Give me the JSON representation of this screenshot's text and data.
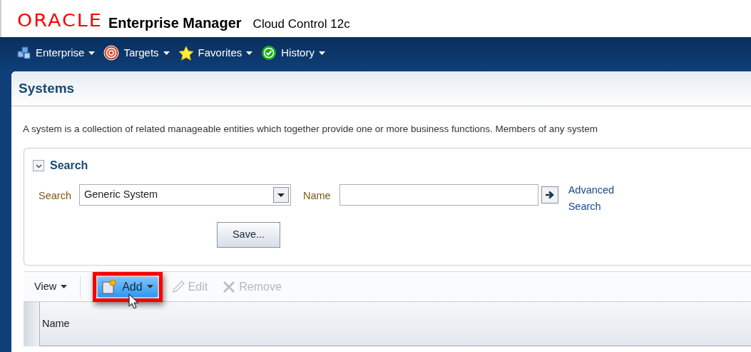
{
  "header": {
    "logo": "ORACLE",
    "product": "Enterprise Manager",
    "edition": "Cloud Control 12c"
  },
  "menu": [
    {
      "label": "Enterprise",
      "kind": "cubes"
    },
    {
      "label": "Targets",
      "kind": "target"
    },
    {
      "label": "Favorites",
      "kind": "star"
    },
    {
      "label": "History",
      "kind": "check"
    }
  ],
  "page": {
    "title": "Systems",
    "description": "A system is a collection of related manageable entities which together provide one or more business functions. Members of any system"
  },
  "search": {
    "title": "Search",
    "expanded": true,
    "type_label": "Search",
    "type_value": "Generic System",
    "name_label": "Name",
    "advanced_link": "Advanced Search",
    "save_button": "Save..."
  },
  "toolbar": [
    {
      "label": "View",
      "kind": "menu"
    },
    {
      "label": "Add",
      "kind": "add",
      "disabled": false,
      "hovered": true
    },
    {
      "label": "Edit",
      "kind": "edit",
      "disabled": true,
      "hovered": false
    },
    {
      "label": "Remove",
      "kind": "remove",
      "disabled": true,
      "hovered": false
    }
  ],
  "table": {
    "columns": [
      "Name"
    ]
  }
}
